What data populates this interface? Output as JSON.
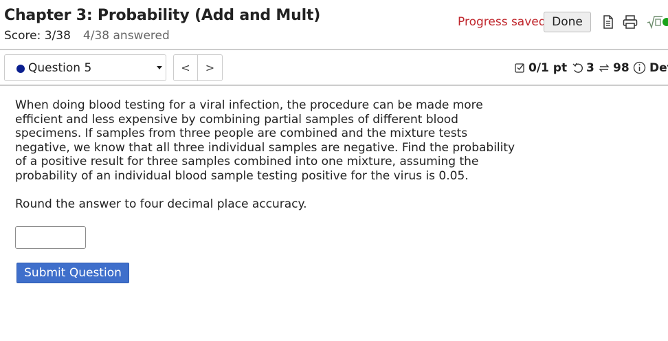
{
  "header": {
    "title": "Chapter 3: Probability (Add and Mult)",
    "score": "Score: 3/38",
    "answered": "4/38 answered",
    "progress_saved": "Progress saved",
    "done_label": "Done",
    "icons": [
      "document-icon",
      "printer-icon",
      "sqrt-icon",
      "status-dot-icon"
    ]
  },
  "question_nav": {
    "selected": "Question 5",
    "prev_symbol": "<",
    "next_symbol": ">",
    "points": "0/1 pt",
    "retries": "3",
    "attempts": "98",
    "details": "Det"
  },
  "question": {
    "text": "When doing blood testing for a viral infection, the procedure can be made more efficient and less expensive by combining partial samples of different blood specimens. If samples from three people are combined and the mixture tests negative, we know that all three individual samples are negative. Find the probability of a positive result for three samples combined into one mixture, assuming the probability of an individual blood sample testing positive for the virus is 0.05.",
    "instruction": "Round the answer to four decimal place accuracy.",
    "answer_value": "",
    "submit_label": "Submit Question"
  },
  "colors": {
    "accent_blue": "#3f6fcb",
    "progress_red": "#c0272d",
    "question_dot": "#0a1f8f",
    "status_green": "#1aa31a"
  }
}
